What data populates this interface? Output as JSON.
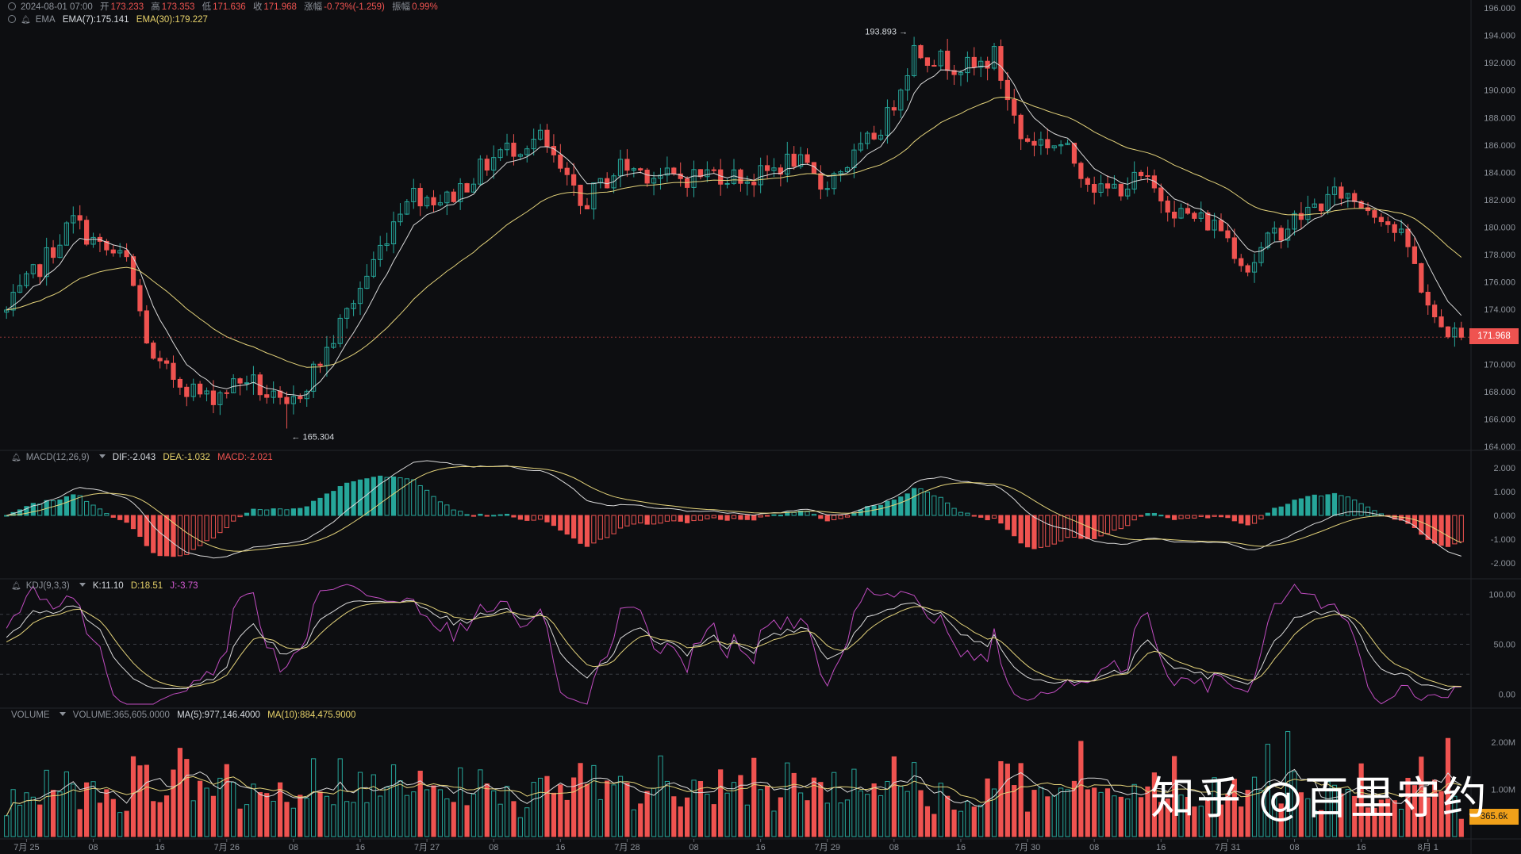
{
  "header": {
    "datetime": "2024-08-01 07:00",
    "open_label": "开",
    "open": "173.233",
    "high_label": "高",
    "high": "173.353",
    "low_label": "低",
    "low": "171.636",
    "close_label": "收",
    "close": "171.968",
    "change_label": "涨幅",
    "change": "-0.73%(-1.259)",
    "amp_label": "振幅",
    "amp": "0.99%"
  },
  "ema": {
    "label": "EMA",
    "ema7": "EMA(7):175.141",
    "ema30": "EMA(30):179.227"
  },
  "macd": {
    "label": "MACD(12,26,9)",
    "dif": "DIF:-2.043",
    "dea": "DEA:-1.032",
    "macd": "MACD:-2.021"
  },
  "kdj": {
    "label": "KDJ(9,3,3)",
    "k": "K:11.10",
    "d": "D:18.51",
    "j": "J:-3.73"
  },
  "volume": {
    "label": "VOLUME",
    "vol": "VOLUME:365,605.0000",
    "ma5": "MA(5):977,146.4000",
    "ma10": "MA(10):884,475.9000"
  },
  "current_price_tag": "171.968",
  "current_volume_tag": "365.6k",
  "watermark": "知乎 @百里守约",
  "colors": {
    "up": "#26a69a",
    "down": "#ef5350",
    "ema7": "#d9d9d9",
    "ema30": "#e3d27a",
    "j_line": "#c04cc0",
    "bg": "#0d0e11"
  },
  "chart_data": [
    {
      "type": "candlestick",
      "ylim": [
        164,
        196
      ],
      "y_ticks": [
        "196.000",
        "194.000",
        "192.000",
        "190.000",
        "188.000",
        "186.000",
        "184.000",
        "182.000",
        "180.000",
        "178.000",
        "176.000",
        "174.000",
        "172.000",
        "170.000",
        "168.000",
        "166.000",
        "164.000"
      ],
      "x_ticks": [
        "7月 25",
        "08",
        "16",
        "7月 26",
        "08",
        "16",
        "7月 27",
        "08",
        "16",
        "7月 28",
        "08",
        "16",
        "7月 29",
        "08",
        "16",
        "7月 30",
        "08",
        "16",
        "7月 31",
        "08",
        "16",
        "8月 1"
      ],
      "annotations": [
        {
          "text": "193.893"
        },
        {
          "text": "165.304"
        }
      ],
      "key_points": [
        {
          "t": 0,
          "price": 173.8
        },
        {
          "t": 10,
          "price": 180.5
        },
        {
          "t": 14,
          "price": 178.5
        },
        {
          "t": 18,
          "price": 177.5
        },
        {
          "t": 22,
          "price": 170.0
        },
        {
          "t": 30,
          "price": 167.5
        },
        {
          "t": 36,
          "price": 169.0
        },
        {
          "t": 42,
          "price": 166.5
        },
        {
          "t": 48,
          "price": 171.0
        },
        {
          "t": 54,
          "price": 176.5
        },
        {
          "t": 60,
          "price": 182.5
        },
        {
          "t": 66,
          "price": 182.0
        },
        {
          "t": 74,
          "price": 185.5
        },
        {
          "t": 80,
          "price": 186.5
        },
        {
          "t": 86,
          "price": 181.5
        },
        {
          "t": 92,
          "price": 184.5
        },
        {
          "t": 100,
          "price": 183.5
        },
        {
          "t": 106,
          "price": 184.0
        },
        {
          "t": 112,
          "price": 183.5
        },
        {
          "t": 118,
          "price": 185.0
        },
        {
          "t": 122,
          "price": 183.0
        },
        {
          "t": 128,
          "price": 185.5
        },
        {
          "t": 132,
          "price": 188.0
        },
        {
          "t": 136,
          "price": 193.0
        },
        {
          "t": 140,
          "price": 192.2
        },
        {
          "t": 145,
          "price": 191.5
        },
        {
          "t": 148,
          "price": 192.5
        },
        {
          "t": 152,
          "price": 186.5
        },
        {
          "t": 158,
          "price": 186.0
        },
        {
          "t": 164,
          "price": 182.5
        },
        {
          "t": 170,
          "price": 183.5
        },
        {
          "t": 176,
          "price": 181.0
        },
        {
          "t": 182,
          "price": 180.0
        },
        {
          "t": 186,
          "price": 177.0
        },
        {
          "t": 190,
          "price": 179.5
        },
        {
          "t": 196,
          "price": 181.5
        },
        {
          "t": 200,
          "price": 182.5
        },
        {
          "t": 206,
          "price": 181.0
        },
        {
          "t": 210,
          "price": 178.5
        },
        {
          "t": 214,
          "price": 173.0
        },
        {
          "t": 218,
          "price": 171.968
        }
      ]
    },
    {
      "type": "bar",
      "name": "MACD",
      "ylim": [
        -2.5,
        2.5
      ],
      "y_ticks": [
        "2.000",
        "1.000",
        "0.000",
        "-1.000",
        "-2.000"
      ]
    },
    {
      "type": "line",
      "name": "KDJ",
      "ylim": [
        -10,
        110
      ],
      "y_ticks": [
        "100.00",
        "50.00",
        "0.00"
      ]
    },
    {
      "type": "bar",
      "name": "VOLUME",
      "ylim": [
        0,
        2.6
      ],
      "y_ticks": [
        "2.00M",
        "1.00M"
      ]
    }
  ]
}
